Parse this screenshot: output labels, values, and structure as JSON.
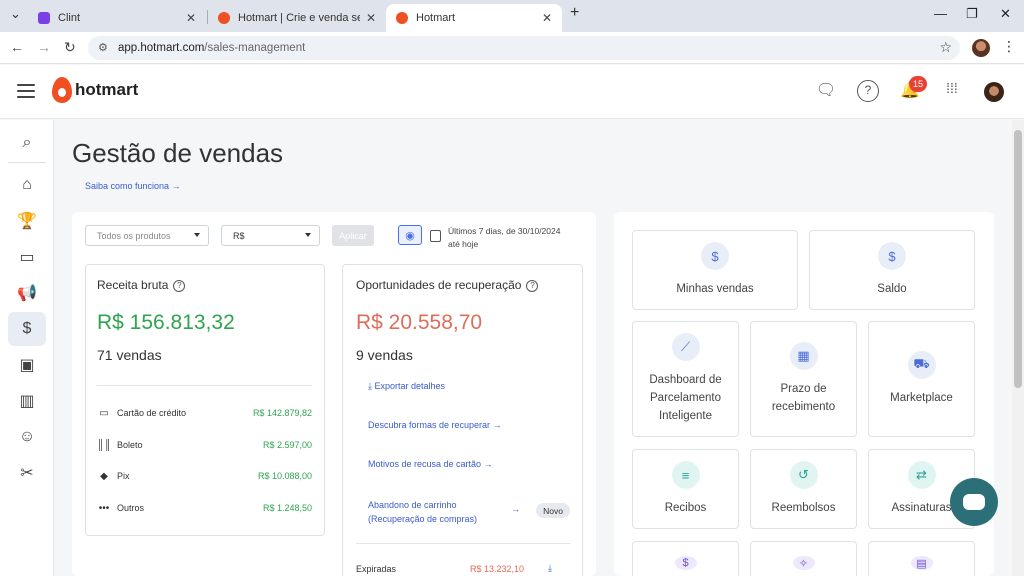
{
  "browser": {
    "tabs": [
      {
        "label": "Clint",
        "icon_color": "#7b3fe4"
      },
      {
        "label": "Hotmart | Crie e venda seu curs",
        "icon_color": "#f04e23"
      },
      {
        "label": "Hotmart",
        "icon_color": "#f04e23",
        "active": true
      }
    ],
    "url_host": "app.hotmart.com",
    "url_path": "/sales-management"
  },
  "header": {
    "logo_text": "hotmart",
    "notifications_count": "15",
    "icons": [
      "chat-icon",
      "help-icon",
      "bell-icon",
      "apps-grid-icon",
      "profile-avatar"
    ]
  },
  "sidebar": {
    "items": [
      "search-icon",
      "home-icon",
      "trophy-icon",
      "folder-icon",
      "megaphone-icon",
      "sales-icon",
      "wallet-icon",
      "bar-chart-icon",
      "contact-card-icon",
      "tools-icon"
    ],
    "active_index": 5
  },
  "page": {
    "title": "Gestão de vendas",
    "learn_link": "Saiba como funciona"
  },
  "filters": {
    "products_placeholder": "Todos os produtos",
    "currency": "R$",
    "apply_label": "Aplicar",
    "date_line1": "Últimos 7 dias, de 30/10/2024",
    "date_line2": "até hoje"
  },
  "gross_revenue": {
    "title": "Receita bruta",
    "value": "R$ 156.813,32",
    "sales": "71 vendas",
    "methods": [
      {
        "label": "Cartão de crédito",
        "value": "R$ 142.879,82",
        "icon": "card-icon"
      },
      {
        "label": "Boleto",
        "value": "R$ 2.597,00",
        "icon": "barcode-icon"
      },
      {
        "label": "Pix",
        "value": "R$ 10.088,00",
        "icon": "pix-icon"
      },
      {
        "label": "Outros",
        "value": "R$ 1.248,50",
        "icon": "more-icon"
      }
    ]
  },
  "recovery": {
    "title": "Oportunidades de recuperação",
    "value": "R$ 20.558,70",
    "sales": "9 vendas",
    "export_label": "Exportar detalhes",
    "links": [
      "Descubra formas de recuperar",
      "Motivos de recusa de cartão"
    ],
    "cart_line1": "Abandono de carrinho",
    "cart_line2": "(Recuperação de compras)",
    "new_badge": "Novo",
    "expired_label": "Expiradas",
    "expired_value": "R$ 13.232,10"
  },
  "tiles": [
    {
      "label": "Minhas vendas",
      "icon": "dollar-icon"
    },
    {
      "label": "Saldo",
      "icon": "money-bag-icon"
    },
    {
      "label": "Dashboard de Parcelamento Inteligente",
      "icon": "line-chart-icon"
    },
    {
      "label": "Prazo de recebimento",
      "icon": "calendar-icon"
    },
    {
      "label": "Marketplace",
      "icon": "cart-icon"
    },
    {
      "label": "Recibos",
      "icon": "receipt-icon"
    },
    {
      "label": "Reembolsos",
      "icon": "refund-icon"
    },
    {
      "label": "Assinaturas",
      "icon": "subscription-icon"
    }
  ],
  "colors": {
    "revenue_green": "#2ea44f",
    "recovery_red": "#e06c5a",
    "link_blue": "#3a5bcd",
    "brand_orange": "#f04e23",
    "chat_fab": "#2c6f78"
  }
}
